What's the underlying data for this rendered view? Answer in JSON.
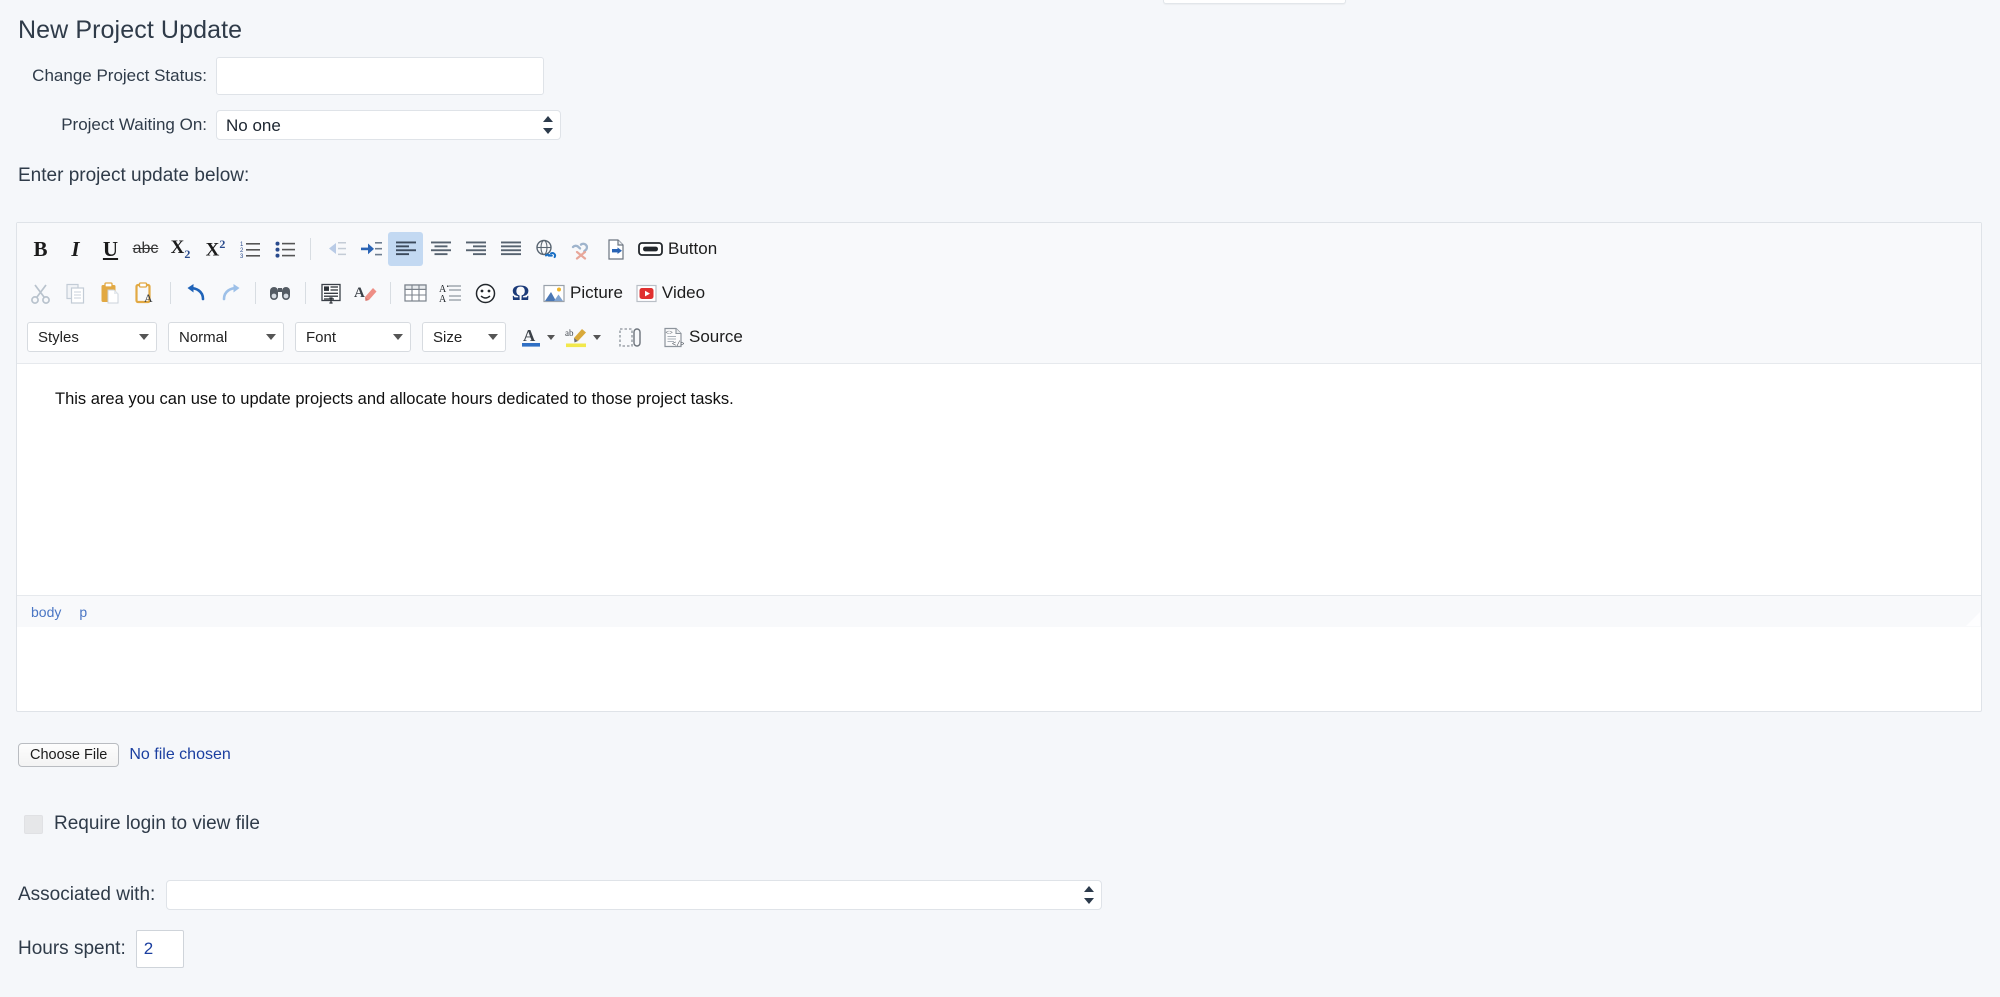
{
  "page": {
    "title": "New Project Update",
    "background_color": "#f5f7fa",
    "text_color": "#2f3b49"
  },
  "form": {
    "status": {
      "label": "Change Project Status:",
      "value": "",
      "placeholder": ""
    },
    "waiting_on": {
      "label": "Project Waiting On:",
      "selected": "No one",
      "options": [
        "No one"
      ]
    },
    "update_heading": "Enter project update below:"
  },
  "editor": {
    "content": "This area you can use to update projects and allocate hours dedicated to those project tasks.",
    "elements_path": [
      "body",
      "p"
    ],
    "toolbar_row1": [
      {
        "name": "bold",
        "glyph": "B"
      },
      {
        "name": "italic",
        "glyph": "I"
      },
      {
        "name": "underline",
        "glyph": "U"
      },
      {
        "name": "strikethrough",
        "glyph": "abc"
      },
      {
        "name": "subscript",
        "glyph": "X2"
      },
      {
        "name": "superscript",
        "glyph": "X2"
      },
      {
        "name": "numbered-list",
        "glyph": ""
      },
      {
        "name": "bulleted-list",
        "glyph": ""
      },
      {
        "name": "decrease-indent",
        "glyph": ""
      },
      {
        "name": "increase-indent",
        "glyph": ""
      },
      {
        "name": "align-left",
        "glyph": ""
      },
      {
        "name": "align-center",
        "glyph": ""
      },
      {
        "name": "align-right",
        "glyph": ""
      },
      {
        "name": "justify",
        "glyph": ""
      },
      {
        "name": "link",
        "glyph": ""
      },
      {
        "name": "unlink",
        "glyph": ""
      },
      {
        "name": "anchor",
        "glyph": ""
      },
      {
        "name": "button",
        "glyph": ""
      }
    ],
    "button_label": "Button",
    "picture_label": "Picture",
    "video_label": "Video",
    "source_label": "Source",
    "combos": {
      "styles": "Styles",
      "format": "Normal",
      "font": "Font",
      "size": "Size"
    }
  },
  "attachment": {
    "choose_file_label": "Choose File",
    "no_file_label": "No file chosen",
    "require_login_label": "Require login to view file",
    "require_login_checked": false
  },
  "associated": {
    "label": "Associated with:",
    "selected": "",
    "options": [
      ""
    ]
  },
  "hours": {
    "label": "Hours spent:",
    "value": "2"
  },
  "colors": {
    "accent_blue": "#2a4b8d",
    "link_blue": "#4a76c4",
    "active_toolbar": "#c3d9f2",
    "value_blue": "#1b3fa0"
  }
}
